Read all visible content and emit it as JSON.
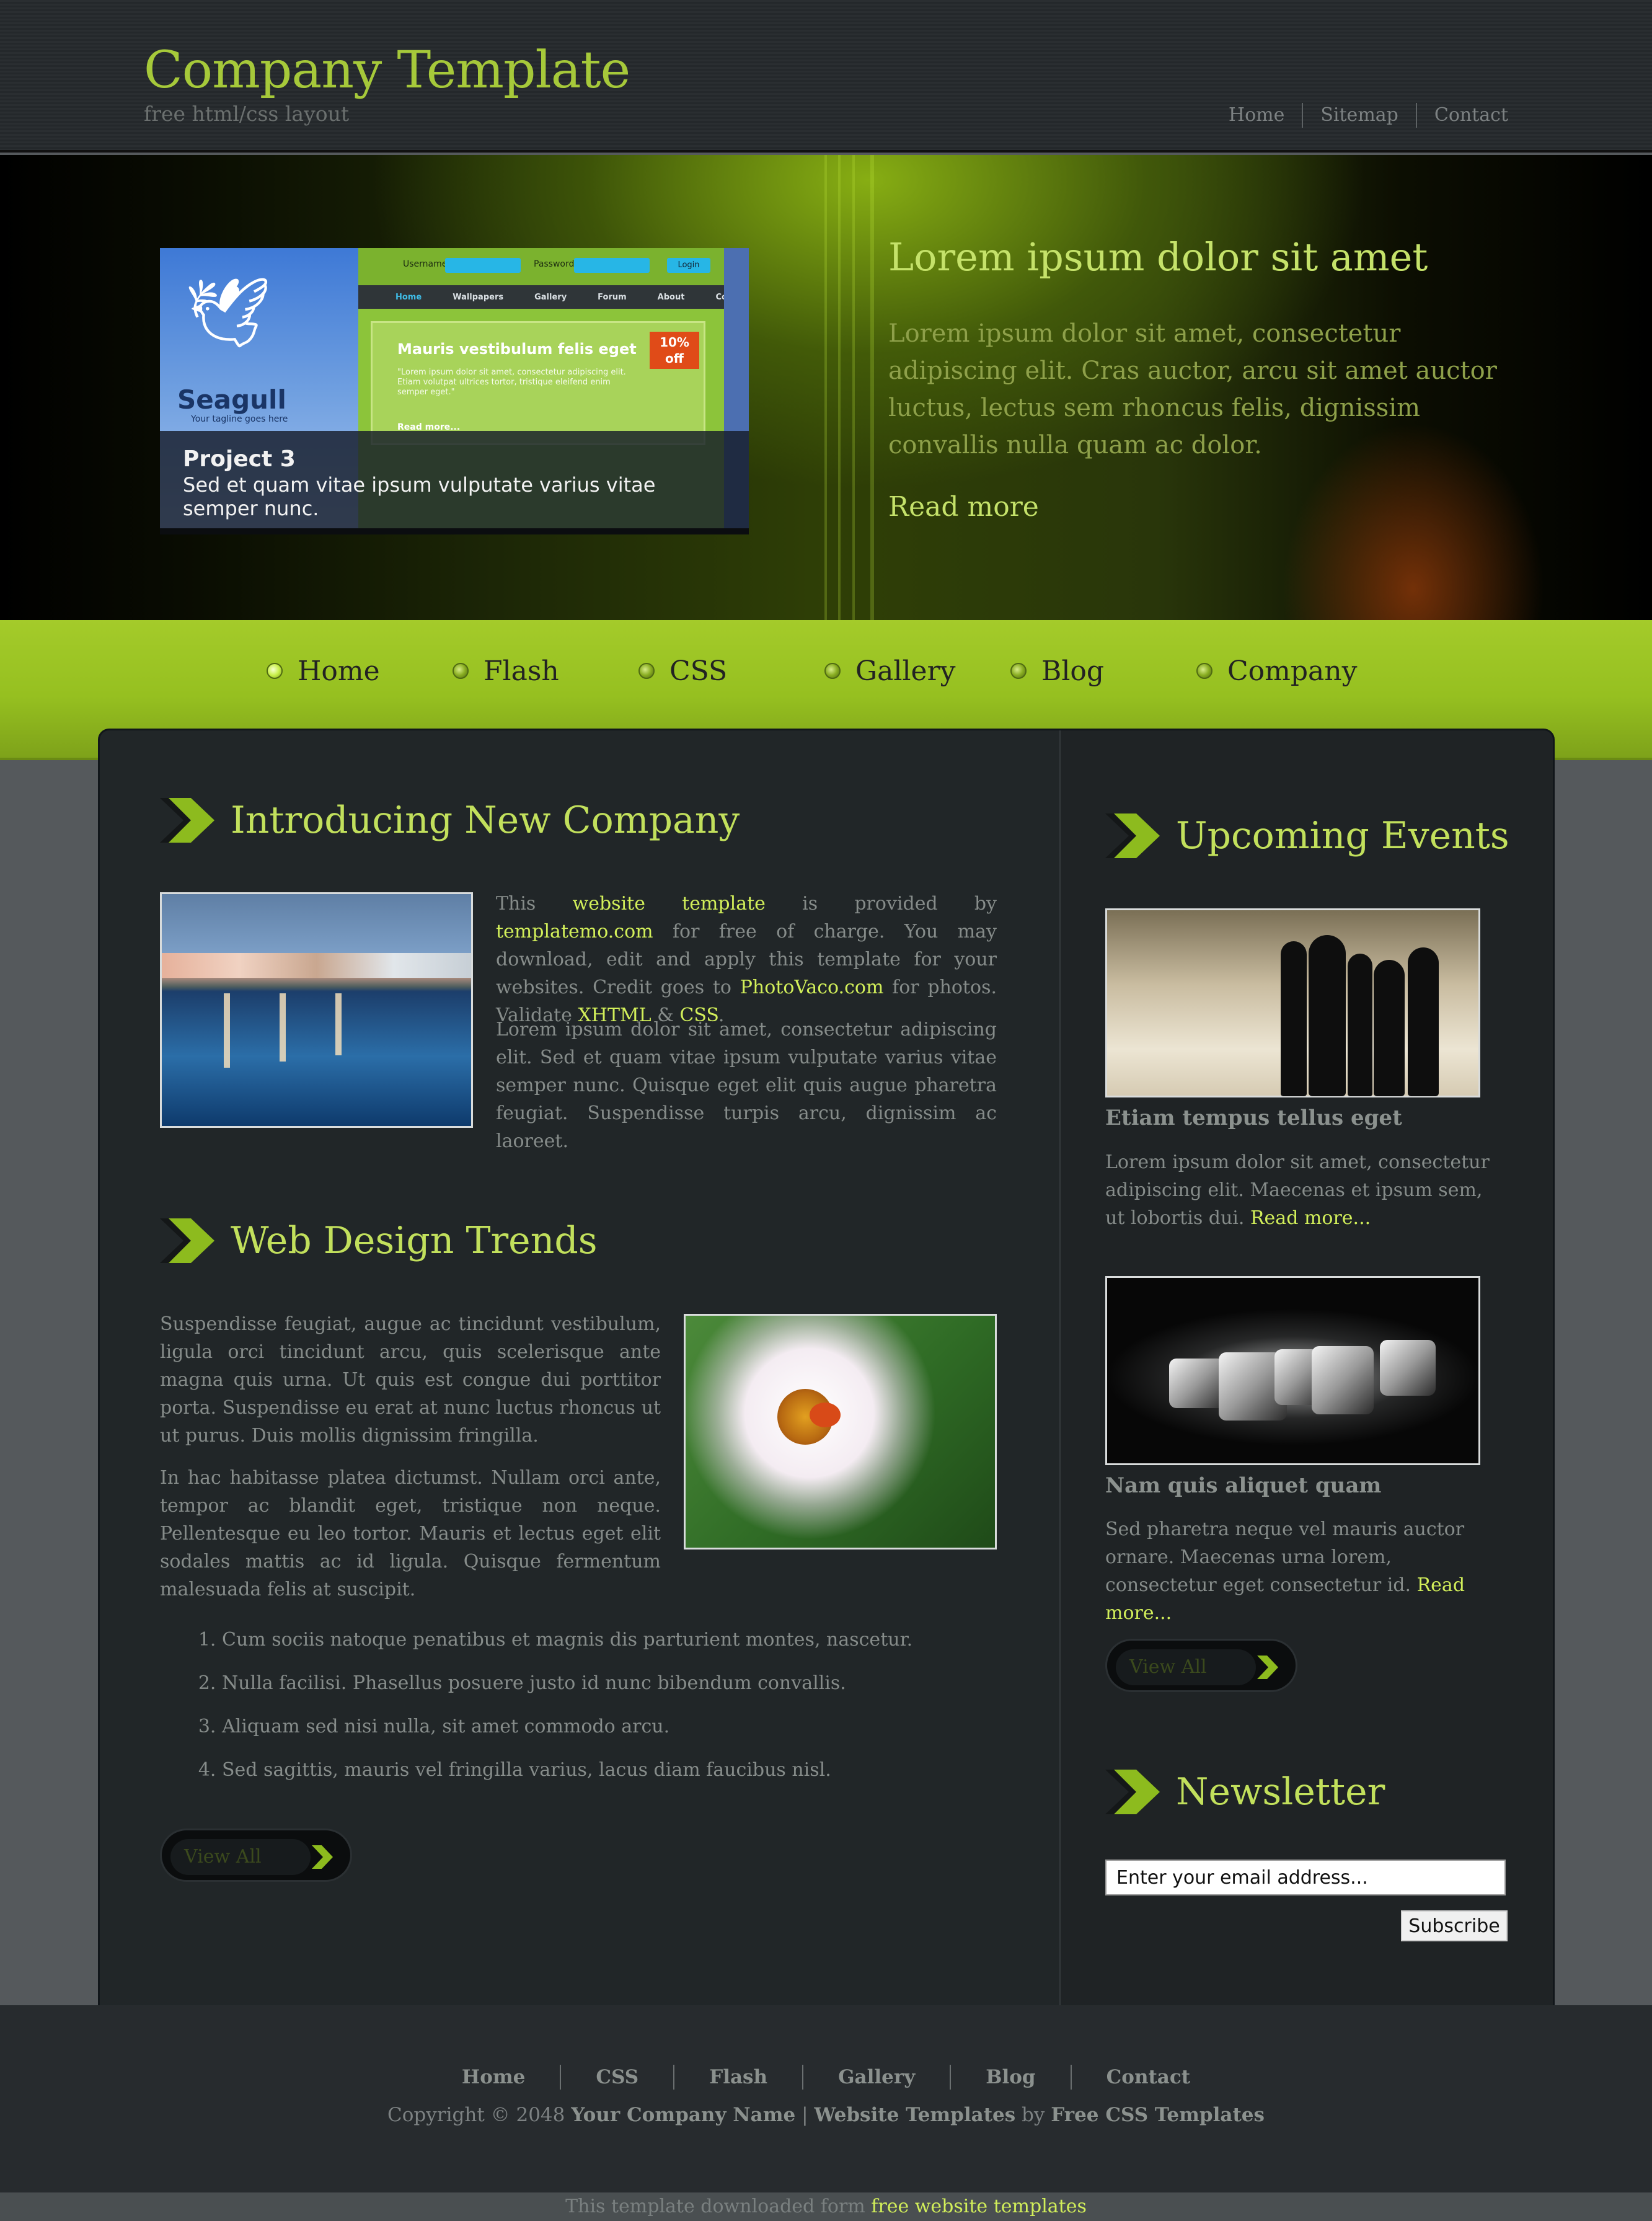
{
  "header": {
    "title": "Company Template",
    "subtitle": "free html/css layout",
    "nav": [
      "Home",
      "Sitemap",
      "Contact"
    ]
  },
  "banner": {
    "slide": {
      "caption_title": "Project 3",
      "caption_text": "Sed et quam vitae ipsum vulputate varius vitae semper nunc.",
      "logo_text": "Seagull",
      "tagline": "Your tagline goes here",
      "username_label": "Username",
      "password_label": "Password",
      "login_label": "Login",
      "menu": [
        "Home",
        "Wallpapers",
        "Gallery",
        "Forum",
        "About",
        "Contact"
      ],
      "card_title": "Mauris vestibulum felis eget",
      "card_text": "\"Lorem ipsum dolor sit amet, consectetur adipiscing elit. Etiam volutpat ultrices tortor, tristique eleifend enim semper eget.\"",
      "card_more": "Read more...",
      "badge": "10% off"
    },
    "title": "Lorem ipsum dolor sit amet",
    "text": "Lorem ipsum dolor sit amet, consectetur adipiscing elit. Cras auctor, arcu sit amet auctor luctus, lectus sem rhoncus felis, dignissim convallis nulla quam ac dolor.",
    "read_more": "Read more"
  },
  "menu": [
    "Home",
    "Flash",
    "CSS",
    "Gallery",
    "Blog",
    "Company"
  ],
  "intro": {
    "title": "Introducing New Company",
    "p1": {
      "t1": "This ",
      "l1": "website template",
      "t2": " is provided by ",
      "l2": "templatemo.com",
      "t3": " for free of charge. You may download, edit and apply this template for your websites. Credit goes to ",
      "l3": "PhotoVaco.com",
      "t4": " for photos. Validate ",
      "l4": "XHTML",
      "t5": " & ",
      "l5": "CSS",
      "t6": "."
    },
    "p2": "Lorem ipsum dolor sit amet, consectetur adipiscing elit. Sed et quam vitae ipsum vulputate varius vitae semper nunc. Quisque eget elit quis augue pharetra feugiat. Suspendisse turpis arcu, dignissim ac laoreet."
  },
  "trends": {
    "title": "Web Design Trends",
    "p1": "Suspendisse feugiat, augue ac tincidunt vestibulum, ligula orci tincidunt arcu, quis scelerisque ante magna quis urna. Ut quis est congue dui porttitor porta. Suspendisse eu erat at nunc luctus rhoncus ut ut purus. Duis mollis dignissim fringilla.",
    "p2": "In hac habitasse platea dictumst. Nullam orci ante, tempor ac blandit eget, tristique non neque. Pellentesque eu leo tortor. Mauris et lectus eget elit sodales mattis ac id ligula. Quisque fermentum malesuada felis at suscipit.",
    "list": [
      "Cum sociis natoque penatibus et magnis dis parturient montes, nascetur.",
      "Nulla facilisi. Phasellus posuere justo id nunc bibendum convallis.",
      "Aliquam sed nisi nulla, sit amet commodo arcu.",
      "Sed sagittis, mauris vel fringilla varius, lacus diam faucibus nisl."
    ],
    "view_all": "View All"
  },
  "events": {
    "title": "Upcoming Events",
    "items": [
      {
        "title": "Etiam tempus tellus eget",
        "text": "Lorem ipsum dolor sit amet, consectetur adipiscing elit. Maecenas et ipsum sem, ut lobortis dui.",
        "more": "Read more..."
      },
      {
        "title": "Nam quis aliquet quam",
        "text": "Sed pharetra neque vel mauris auctor ornare. Maecenas urna lorem, consectetur eget consectetur id.",
        "more": "Read more..."
      }
    ],
    "view_all": "View All"
  },
  "newsletter": {
    "title": "Newsletter",
    "email_value": "Enter your email address...",
    "subscribe": "Subscribe"
  },
  "footer": {
    "nav": [
      "Home",
      "CSS",
      "Flash",
      "Gallery",
      "Blog",
      "Contact"
    ],
    "copy_prefix": "Copyright © 2048 ",
    "company": "Your Company Name",
    "sep": " | ",
    "templates": "Website Templates",
    "by": " by ",
    "free_css": "Free CSS Templates",
    "bottom_text": "This template downloaded form ",
    "bottom_link": "free website templates"
  },
  "colors": {
    "accent": "#a6c93a",
    "link": "#d2ef5a",
    "menu_green": "#96c020",
    "panel": "#212628"
  }
}
